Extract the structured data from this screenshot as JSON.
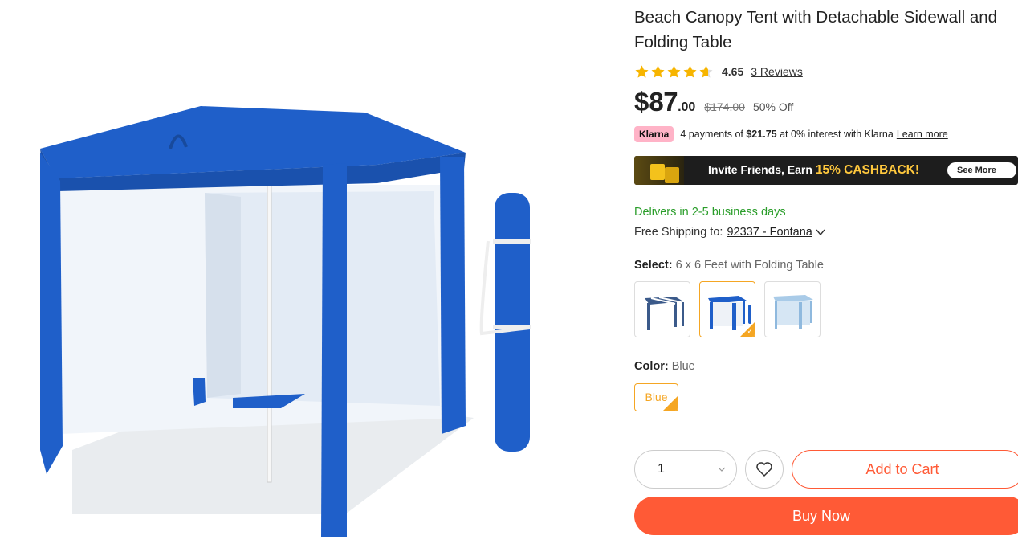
{
  "product": {
    "title": "Beach Canopy Tent with Detachable Sidewall and Folding Table",
    "rating": 4.65,
    "rating_label": "4.65",
    "reviews_label": "3 Reviews",
    "stars_filled": 4.65
  },
  "price": {
    "currency": "$",
    "integer": "87",
    "decimal": ".00",
    "original": "$174.00",
    "discount": "50% Off"
  },
  "klarna": {
    "badge": "Klarna",
    "text_prefix": "4 payments of ",
    "amount": "$21.75",
    "text_suffix": " at 0% interest with Klarna",
    "learn_more": "Learn more"
  },
  "promo_banner": {
    "text": "Invite Friends, Earn ",
    "highlight": "15% CASHBACK!",
    "button": "See More"
  },
  "delivery": {
    "estimate": "Delivers in 2-5 business days",
    "shipping_label": "Free Shipping to:",
    "zip": "92337 - Fontana"
  },
  "variant": {
    "select_label": "Select:",
    "select_value": "6 x 6 Feet with Folding Table",
    "selected_index": 1,
    "color_label": "Color:",
    "color_value": "Blue",
    "color_option": "Blue"
  },
  "actions": {
    "quantity": "1",
    "add_to_cart": "Add to Cart",
    "buy_now": "Buy Now"
  },
  "colors": {
    "accent": "#ff5a36",
    "selection": "#f5a623",
    "delivery_green": "#2a9d2a",
    "tent_blue": "#1f5fc9",
    "star": "#f7b500"
  }
}
